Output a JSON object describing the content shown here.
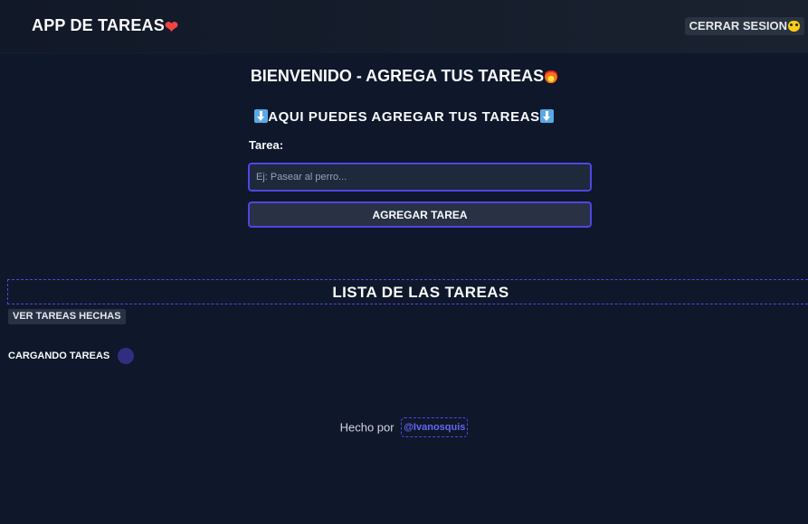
{
  "header": {
    "title": "APP DE TAREAS",
    "title_icon": "heart-icon",
    "logout_label": "CERRAR SESION",
    "logout_icon": "cat-icon"
  },
  "main": {
    "welcome": "BIENVENIDO - AGREGA TUS TAREAS",
    "welcome_icon": "fire-icon",
    "subheading": "AQUI PUEDES AGREGAR TUS TAREAS",
    "subheading_icons": [
      "down-arrow-icon",
      "down-arrow-icon"
    ],
    "form": {
      "label": "Tarea:",
      "placeholder": "Ej: Pasear al perro...",
      "value": "",
      "submit_label": "AGREGAR TAREA"
    }
  },
  "task_list": {
    "title": "LISTA DE LAS TAREAS",
    "view_done_label": "VER TAREAS HECHAS",
    "loading_text": "CARGANDO TAREAS"
  },
  "footer": {
    "text": "Hecho por",
    "link_text": "@Ivanosquis"
  },
  "colors": {
    "background": "#0f172a",
    "accent": "#4f46e5",
    "link": "#6366f1"
  }
}
